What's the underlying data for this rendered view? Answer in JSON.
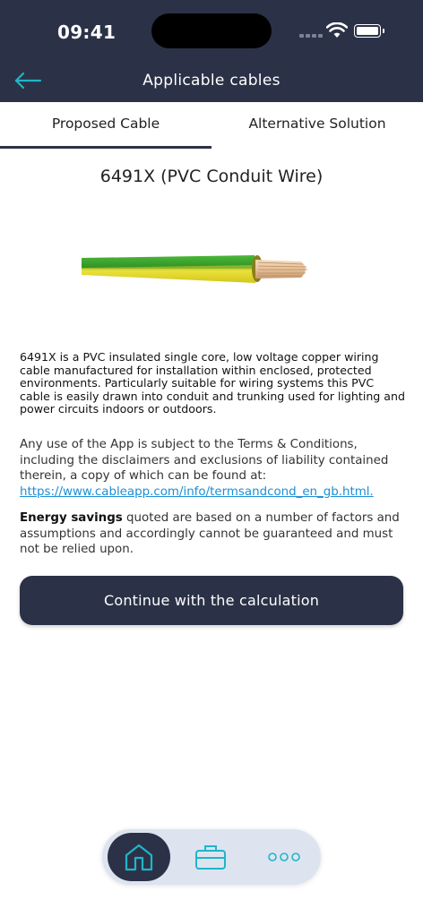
{
  "status_bar": {
    "time": "09:41"
  },
  "header": {
    "title": "Applicable cables"
  },
  "tabs": [
    {
      "label": "Proposed Cable",
      "selected": true
    },
    {
      "label": "Alternative Solution",
      "selected": false
    }
  ],
  "cable": {
    "name": "6491X (PVC Conduit Wire)",
    "description": "6491X is a PVC insulated single core, low voltage copper wiring cable manufactured for installation within enclosed, protected environments. Particularly suitable for wiring systems this PVC cable is easily drawn into conduit and trunking used for lighting and power circuits indoors or outdoors."
  },
  "terms": {
    "text": "Any use of the App is subject to the Terms & Conditions, including the disclaimers and exclusions of liability contained therein, a copy of which can be found at: ",
    "link": "https://www.cableapp.com/info/termsandcond_en_gb.html."
  },
  "energy": {
    "bold": "Energy savings",
    "text": " quoted are based on a number of factors and assumptions and accordingly cannot be guaranteed and must not be relied upon."
  },
  "cta_label": "Continue with the calculation",
  "bottom_nav": [
    {
      "icon": "home-icon",
      "active": true
    },
    {
      "icon": "briefcase-icon",
      "active": false
    },
    {
      "icon": "more-dots-icon",
      "active": false
    }
  ],
  "colors": {
    "header_bg": "#2b3247",
    "accent_teal": "#1fb5c9",
    "link_blue": "#1a8fd6",
    "wire_green": "#3aa12c",
    "wire_yellow": "#e4dd2a",
    "copper": "#e7c19a"
  }
}
